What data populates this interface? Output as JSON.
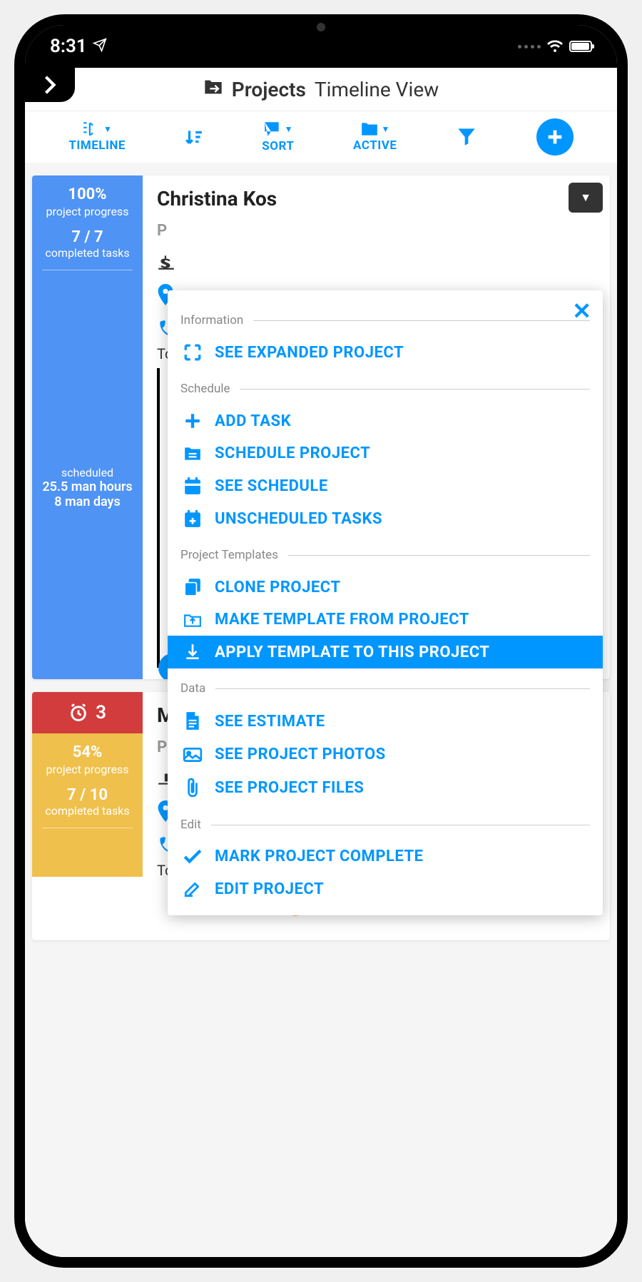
{
  "status": {
    "time": "8:31"
  },
  "header": {
    "title": "Projects",
    "subtitle": "Timeline View"
  },
  "toolbar": {
    "timeline": "TIMELINE",
    "sort": "SORT",
    "active": "ACTIVE"
  },
  "cards": [
    {
      "name": "Christina Kos",
      "progress_pct": "100%",
      "progress_label": "project progress",
      "tasks": "7 / 7",
      "tasks_label": "completed tasks",
      "scheduled_label": "scheduled",
      "man_hours": "25.5 man hours",
      "man_days": "8 man days",
      "today": "Today",
      "p_label": "P"
    },
    {
      "name": "Ma",
      "alarm_count": "3",
      "progress_pct": "54%",
      "progress_label": "project progress",
      "tasks": "7 / 10",
      "tasks_label": "completed tasks",
      "today": "Today",
      "p_label": "P"
    }
  ],
  "popup": {
    "sections": {
      "information": "Information",
      "schedule": "Schedule",
      "templates": "Project Templates",
      "data": "Data",
      "edit": "Edit"
    },
    "items": {
      "see_expanded": "SEE EXPANDED PROJECT",
      "add_task": "ADD TASK",
      "schedule_project": "SCHEDULE PROJECT",
      "see_schedule": "SEE SCHEDULE",
      "unscheduled": "UNSCHEDULED TASKS",
      "clone": "CLONE PROJECT",
      "make_template": "MAKE TEMPLATE FROM PROJECT",
      "apply_template": "APPLY TEMPLATE TO THIS PROJECT",
      "see_estimate": "SEE ESTIMATE",
      "see_photos": "SEE PROJECT PHOTOS",
      "see_files": "SEE PROJECT FILES",
      "mark_complete": "MARK PROJECT COMPLETE",
      "edit_project": "EDIT PROJECT"
    }
  }
}
